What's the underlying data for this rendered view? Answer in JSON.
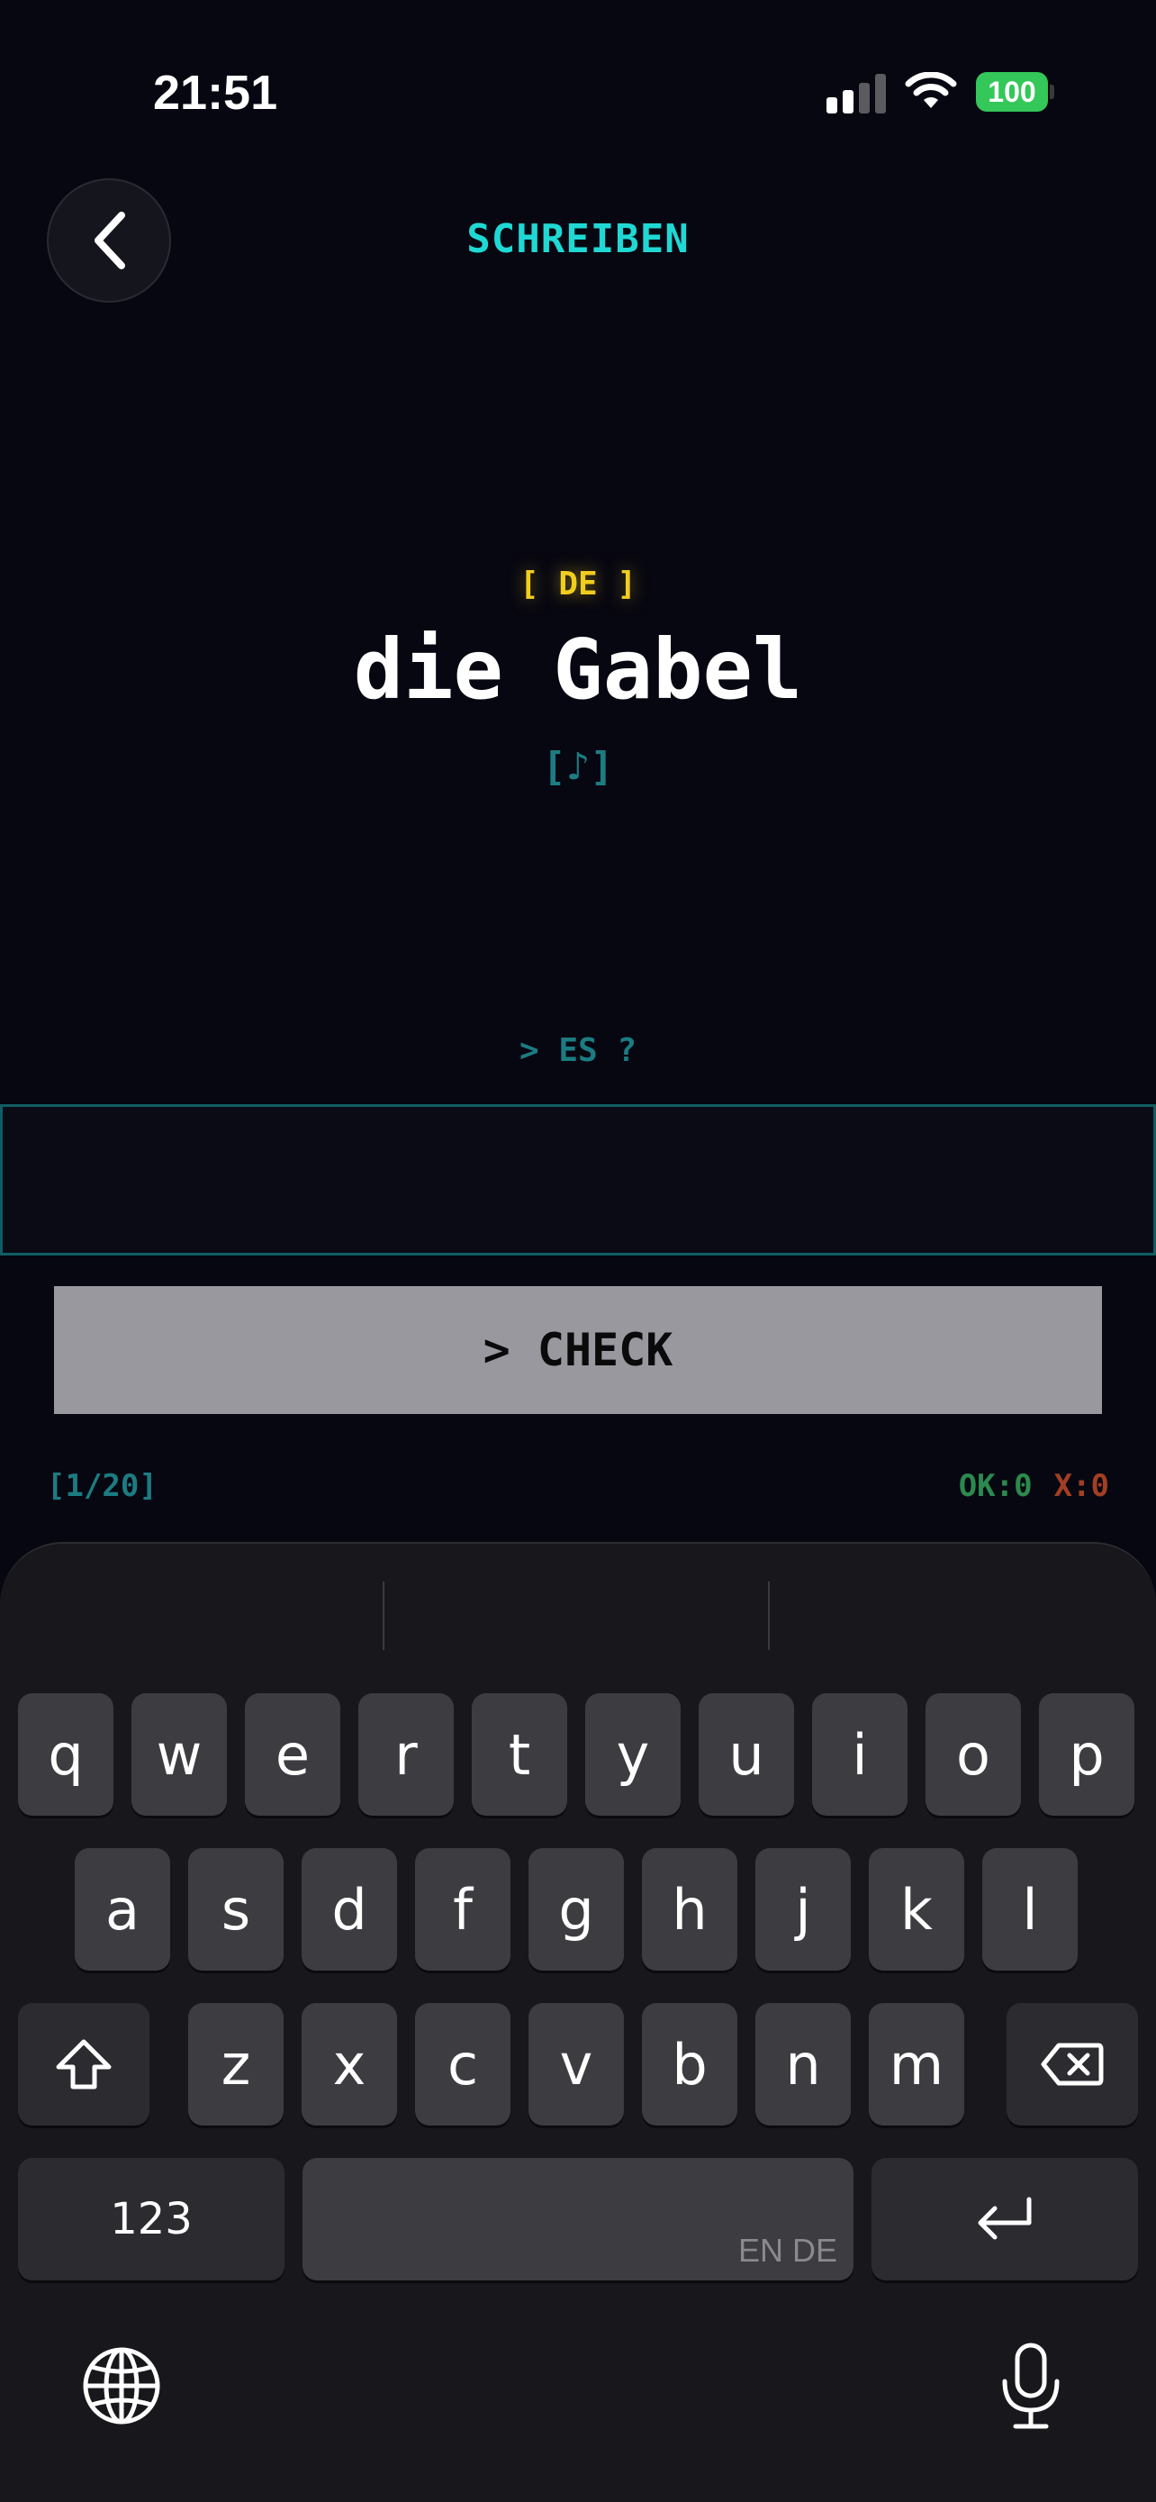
{
  "status": {
    "time": "21:51",
    "battery": "100"
  },
  "header": {
    "title": "SCHREIBEN"
  },
  "card": {
    "language": "[ DE ]",
    "word": "die Gabel",
    "audio": "[♪]"
  },
  "prompt": "> ES ?",
  "input": {
    "value": "",
    "placeholder": ""
  },
  "check_label": "> CHECK",
  "footer": {
    "progress": "[1/20]",
    "ok": "OK:0",
    "wrong": "X:0"
  },
  "keyboard": {
    "row1": [
      "q",
      "w",
      "e",
      "r",
      "t",
      "y",
      "u",
      "i",
      "o",
      "p"
    ],
    "row2": [
      "a",
      "s",
      "d",
      "f",
      "g",
      "h",
      "j",
      "k",
      "l"
    ],
    "row3": [
      "z",
      "x",
      "c",
      "v",
      "b",
      "n",
      "m"
    ],
    "numbers_label": "123",
    "space_languages": "EN DE"
  },
  "colors": {
    "accent": "#1fd8d4",
    "tag": "#f1cd1f",
    "dim": "#1b7c82",
    "ok": "#2b8a4e",
    "wrong": "#a23e23",
    "battery": "#34c759"
  }
}
